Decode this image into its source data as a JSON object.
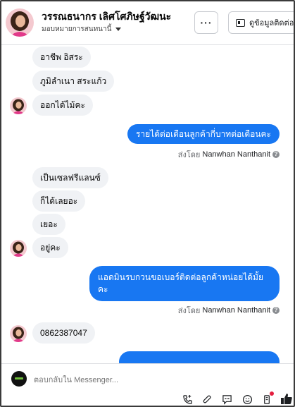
{
  "header": {
    "name": "วรรณธนากร เลิศโศภิษฐ์วัฒนะ",
    "assign_label": "มอบหมายการสนทนานี้",
    "more_label": "···",
    "contact_label": "ดูข้อมูลติดต่อ"
  },
  "messages": {
    "m1": "อาชีพ อิสระ",
    "m2": "ภูมิลำเนา  สระแก้ว",
    "m3": "ออกได้ไม้คะ",
    "m4": "รายได้ต่อเดือนลูกค้ากี่บาทต่อเดือนคะ",
    "m5": "เป็นเซลฟรีแลนซ์",
    "m6": "ก็ได้เลยอะ",
    "m7": "เยอะ",
    "m8": "อยู่คะ",
    "m9_line1": "แอดมินรบกวนขอเบอร์ติดต่อลูกค้าหน่อยได้มั้ย",
    "m9_line2": "คะ",
    "m10": "0862387047"
  },
  "sent_by": {
    "prefix": "ส่งโดย",
    "name": "Nanwhan Nanthanit",
    "help": "?"
  },
  "composer": {
    "placeholder": "ตอบกลับใน Messenger..."
  },
  "colors": {
    "accent": "#1877f2",
    "incoming_bubble": "#f0f2f5",
    "like": "#1c1e21"
  },
  "icons": [
    "more-icon",
    "contact-card-icon",
    "phone-icon",
    "attachment-icon",
    "saved-reply-icon",
    "emoji-icon",
    "bookmark-icon",
    "like-icon"
  ]
}
